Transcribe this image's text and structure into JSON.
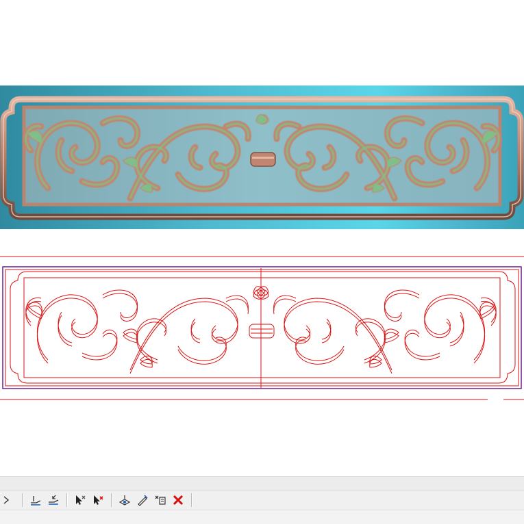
{
  "colors": {
    "background": "#ffffff",
    "relief_background": "#4fb9cf",
    "relief_bronze": "#c08670",
    "relief_green": "#7fc08a",
    "vector_red": "#dd1111",
    "vector_purple": "#6b1f8f",
    "toolbar_bg": "#f0f0f0"
  },
  "panels": {
    "top": "3d-relief-render",
    "bottom": "2d-vector-outline"
  },
  "toolbar": {
    "buttons": [
      {
        "name": "play-arrow-icon"
      },
      {
        "name": "layer-flatten-icon"
      },
      {
        "name": "layer-offset-icon"
      },
      {
        "name": "select-remove-cursor-icon"
      },
      {
        "name": "delete-select-cursor-icon"
      },
      {
        "name": "node-edit-icon"
      },
      {
        "name": "pen-edit-icon"
      },
      {
        "name": "text-cursor-remove-icon"
      },
      {
        "name": "close-red-x-icon"
      }
    ]
  }
}
